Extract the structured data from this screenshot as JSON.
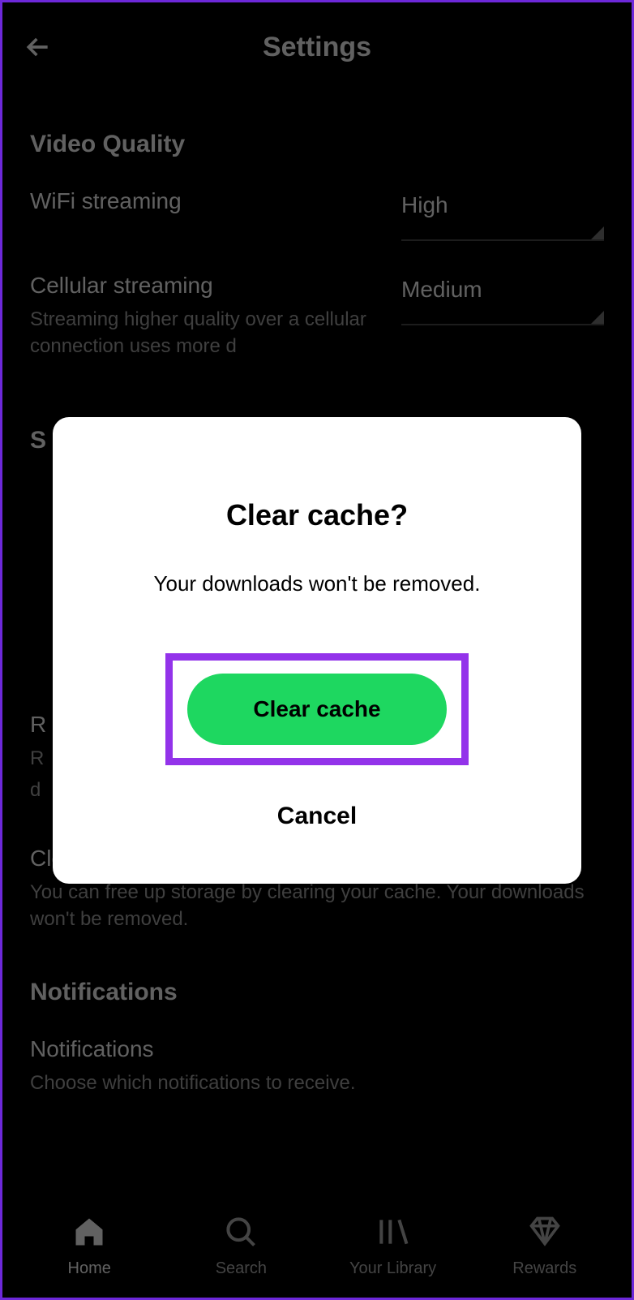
{
  "header": {
    "title": "Settings"
  },
  "sections": {
    "video_quality": {
      "title": "Video Quality",
      "wifi": {
        "label": "WiFi streaming",
        "value": "High"
      },
      "cellular": {
        "label": "Cellular streaming",
        "desc": "Streaming higher quality over a cellular connection uses more d",
        "value": "Medium"
      }
    },
    "storage_hidden_letter": "S",
    "remove_hidden": {
      "label_initial": "R",
      "desc_initial": "R",
      "desc_line2": "d"
    },
    "clear_cache": {
      "label": "Clear cache",
      "desc": "You can free up storage by clearing your cache. Your downloads won't be removed."
    },
    "notifications": {
      "title": "Notifications",
      "item_label": "Notifications",
      "item_desc": "Choose which notifications to receive."
    }
  },
  "dialog": {
    "title": "Clear cache?",
    "message": "Your downloads won't be removed.",
    "confirm": "Clear cache",
    "cancel": "Cancel"
  },
  "nav": {
    "home": "Home",
    "search": "Search",
    "library": "Your Library",
    "rewards": "Rewards"
  }
}
